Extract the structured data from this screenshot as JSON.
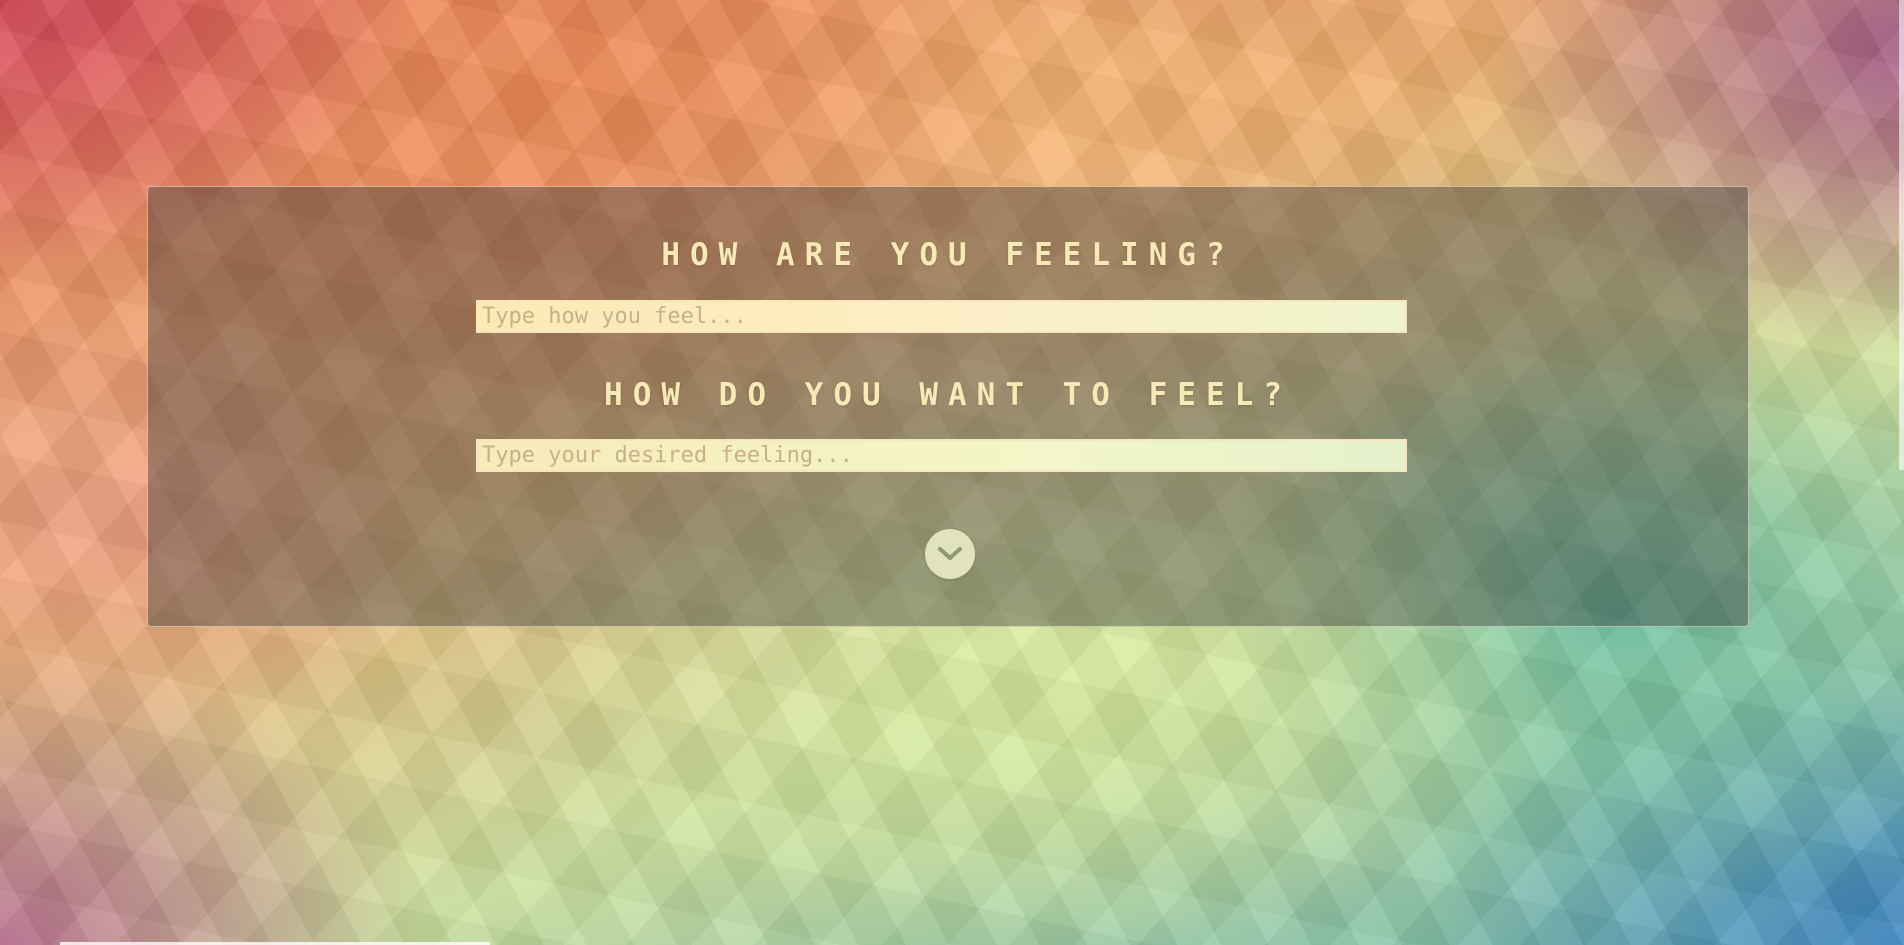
{
  "form": {
    "current_feeling": {
      "question": "HOW ARE YOU FEELING?",
      "placeholder": "Type how you feel...",
      "value": ""
    },
    "desired_feeling": {
      "question": "HOW DO YOU WANT TO FEEL?",
      "placeholder": "Type your desired feeling...",
      "value": ""
    },
    "submit_icon": "chevron-down-icon"
  },
  "colors": {
    "heading_text": "#f8e9b7",
    "panel_overlay": "rgba(60,60,60,0.42)",
    "submit_button": "#e1e3bd",
    "chevron": "#8d9a76"
  }
}
